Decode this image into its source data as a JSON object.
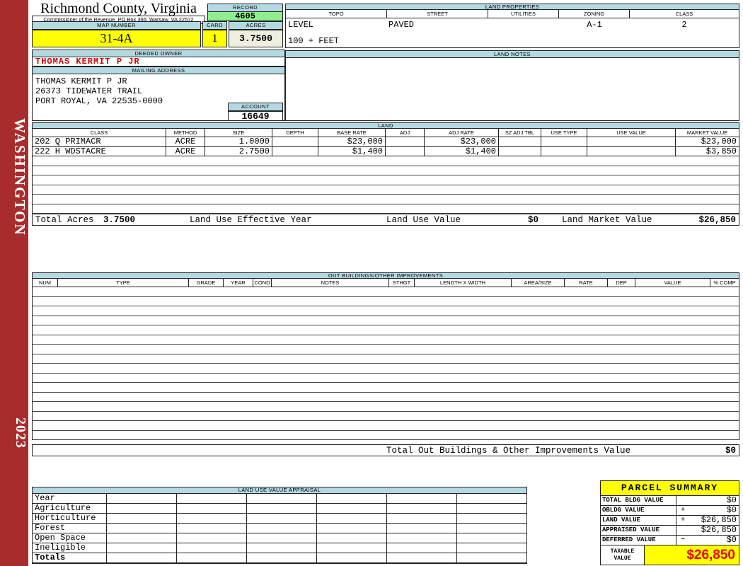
{
  "colors": {
    "band": "#B3D9E3",
    "green": "#90EE90",
    "yellow": "#FFFF00",
    "cream": "#EFEFE0",
    "sidebar": "#A92C2C",
    "ownerred": "#CC0000",
    "bigred": "#EE0000"
  },
  "sidebar": {
    "county": "WASHINGTON",
    "year": "2023"
  },
  "header": {
    "title": "Richmond County, Virginia",
    "subtitle": "Commissioner of the Revenue, PO Box 366, Warsaw, VA 22572",
    "record_label": "RECORD",
    "record_value": "4605",
    "map_number_label": "MAP NUMBER",
    "map_number_value": "31-4A",
    "card_label": "CARD",
    "card_value": "1",
    "acres_label": "ACRES",
    "acres_value": "3.7500"
  },
  "land_properties": {
    "title": "LAND PROPERTIES",
    "columns": [
      "TOPO",
      "STREET",
      "UTILITIES",
      "ZONING",
      "CLASS"
    ],
    "values": [
      "LEVEL",
      "PAVED",
      "",
      "A-1",
      "2"
    ],
    "note": "100 + FEET"
  },
  "owner": {
    "deeded_owner_label": "DEEDED OWNER",
    "deeded_owner": "THOMAS KERMIT P JR",
    "mailing_address_label": "MAILING ADDRESS",
    "address_lines": [
      "THOMAS KERMIT P JR",
      "26373 TIDEWATER TRAIL",
      "",
      "PORT ROYAL, VA 22535-0000"
    ],
    "account_label": "ACCOUNT",
    "account_value": "16649"
  },
  "land_notes": {
    "title": "LAND NOTES"
  },
  "land_table": {
    "title": "LAND",
    "columns": [
      "CLASS",
      "METHOD",
      "SIZE",
      "DEPTH",
      "BASE RATE",
      "ADJ",
      "ADJ RATE",
      "SZ ADJ TBL",
      "USE TYPE",
      "USE VALUE",
      "MARKET VALUE"
    ],
    "rows": [
      {
        "class": "202 Q PRIMACR",
        "method": "ACRE",
        "size": "1.0000",
        "depth": "",
        "base_rate": "$23,000",
        "adj": "",
        "adj_rate": "$23,000",
        "sz_adj_tbl": "",
        "use_type": "",
        "use_value": "",
        "market_value": "$23,000"
      },
      {
        "class": "222 H WDSTACRE",
        "method": "ACRE",
        "size": "2.7500",
        "depth": "",
        "base_rate": "$1,400",
        "adj": "",
        "adj_rate": "$1,400",
        "sz_adj_tbl": "",
        "use_type": "",
        "use_value": "",
        "market_value": "$3,850"
      }
    ],
    "empty_rows": 6,
    "totals": {
      "total_acres_label": "Total Acres",
      "total_acres": "3.7500",
      "effective_year_label": "Land Use Effective Year",
      "land_use_value_label": "Land Use Value",
      "land_use_value": "$0",
      "land_market_value_label": "Land Market Value",
      "land_market_value": "$26,850"
    }
  },
  "out_buildings": {
    "title": "OUT BUILDINGS/OTHER IMPROVEMENTS",
    "columns": [
      "NUM",
      "TYPE",
      "GRADE",
      "YEAR",
      "COND",
      "NOTES",
      "STHGT",
      "LENGTH X WIDTH",
      "AREA/SIZE",
      "RATE",
      "DEP",
      "VALUE",
      "% COMP"
    ],
    "empty_rows": 16,
    "total_label": "Total Out Buildings & Other Improvements Value",
    "total_value": "$0"
  },
  "land_use_appraisal": {
    "title": "LAND USE VALUE APPRAISAL",
    "row_labels": [
      "Year",
      "Agriculture",
      "Horticulture",
      "Forest",
      "Open Space",
      "Ineligible",
      "Totals"
    ],
    "data_columns": 6
  },
  "parcel_summary": {
    "title": "PARCEL SUMMARY",
    "rows": [
      {
        "label": "TOTAL BLDG VALUE",
        "op": "",
        "value": "$0"
      },
      {
        "label": "OBLDG VALUE",
        "op": "+",
        "value": "$0"
      },
      {
        "label": "LAND VALUE",
        "op": "+",
        "value": "$26,850"
      },
      {
        "label": "APPRAISED VALUE",
        "op": "",
        "value": "$26,850"
      },
      {
        "label": "DEFERRED VALUE",
        "op": "−",
        "value": "$0"
      }
    ],
    "taxable_label": "TAXABLE VALUE",
    "taxable_value": "$26,850"
  }
}
